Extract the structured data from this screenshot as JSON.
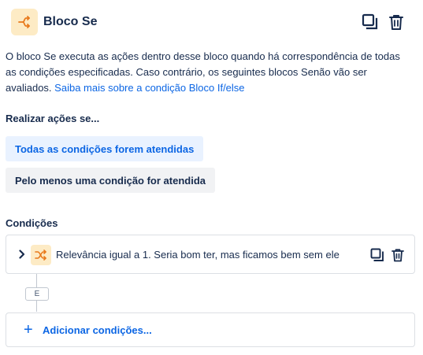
{
  "header": {
    "title": "Bloco Se",
    "icon": "branch-icon",
    "accent": "#f5a623"
  },
  "description": {
    "text": "O bloco Se executa as ações dentro desse bloco quando há correspondência de todas as condições especificadas. Caso contrário, os seguintes blocos Senão vão ser avaliados.",
    "link": "Saiba mais sobre a condição Bloco If/else"
  },
  "perform": {
    "label": "Realizar ações se...",
    "options": [
      {
        "label": "Todas as condições forem atendidas",
        "selected": true
      },
      {
        "label": "Pelo menos uma condição for atendida",
        "selected": false
      }
    ]
  },
  "conditions": {
    "label": "Condições",
    "items": [
      {
        "text": "Relevância igual a 1. Seria bom ter, mas ficamos bem sem ele",
        "icon": "shuffle-icon"
      }
    ],
    "and_label": "E",
    "add_label": "Adicionar condições..."
  },
  "colors": {
    "link": "#0c66e4",
    "selected_bg": "#e9f2ff",
    "unselected_bg": "#f1f2f4",
    "icon_bg": "#fdebc5"
  }
}
